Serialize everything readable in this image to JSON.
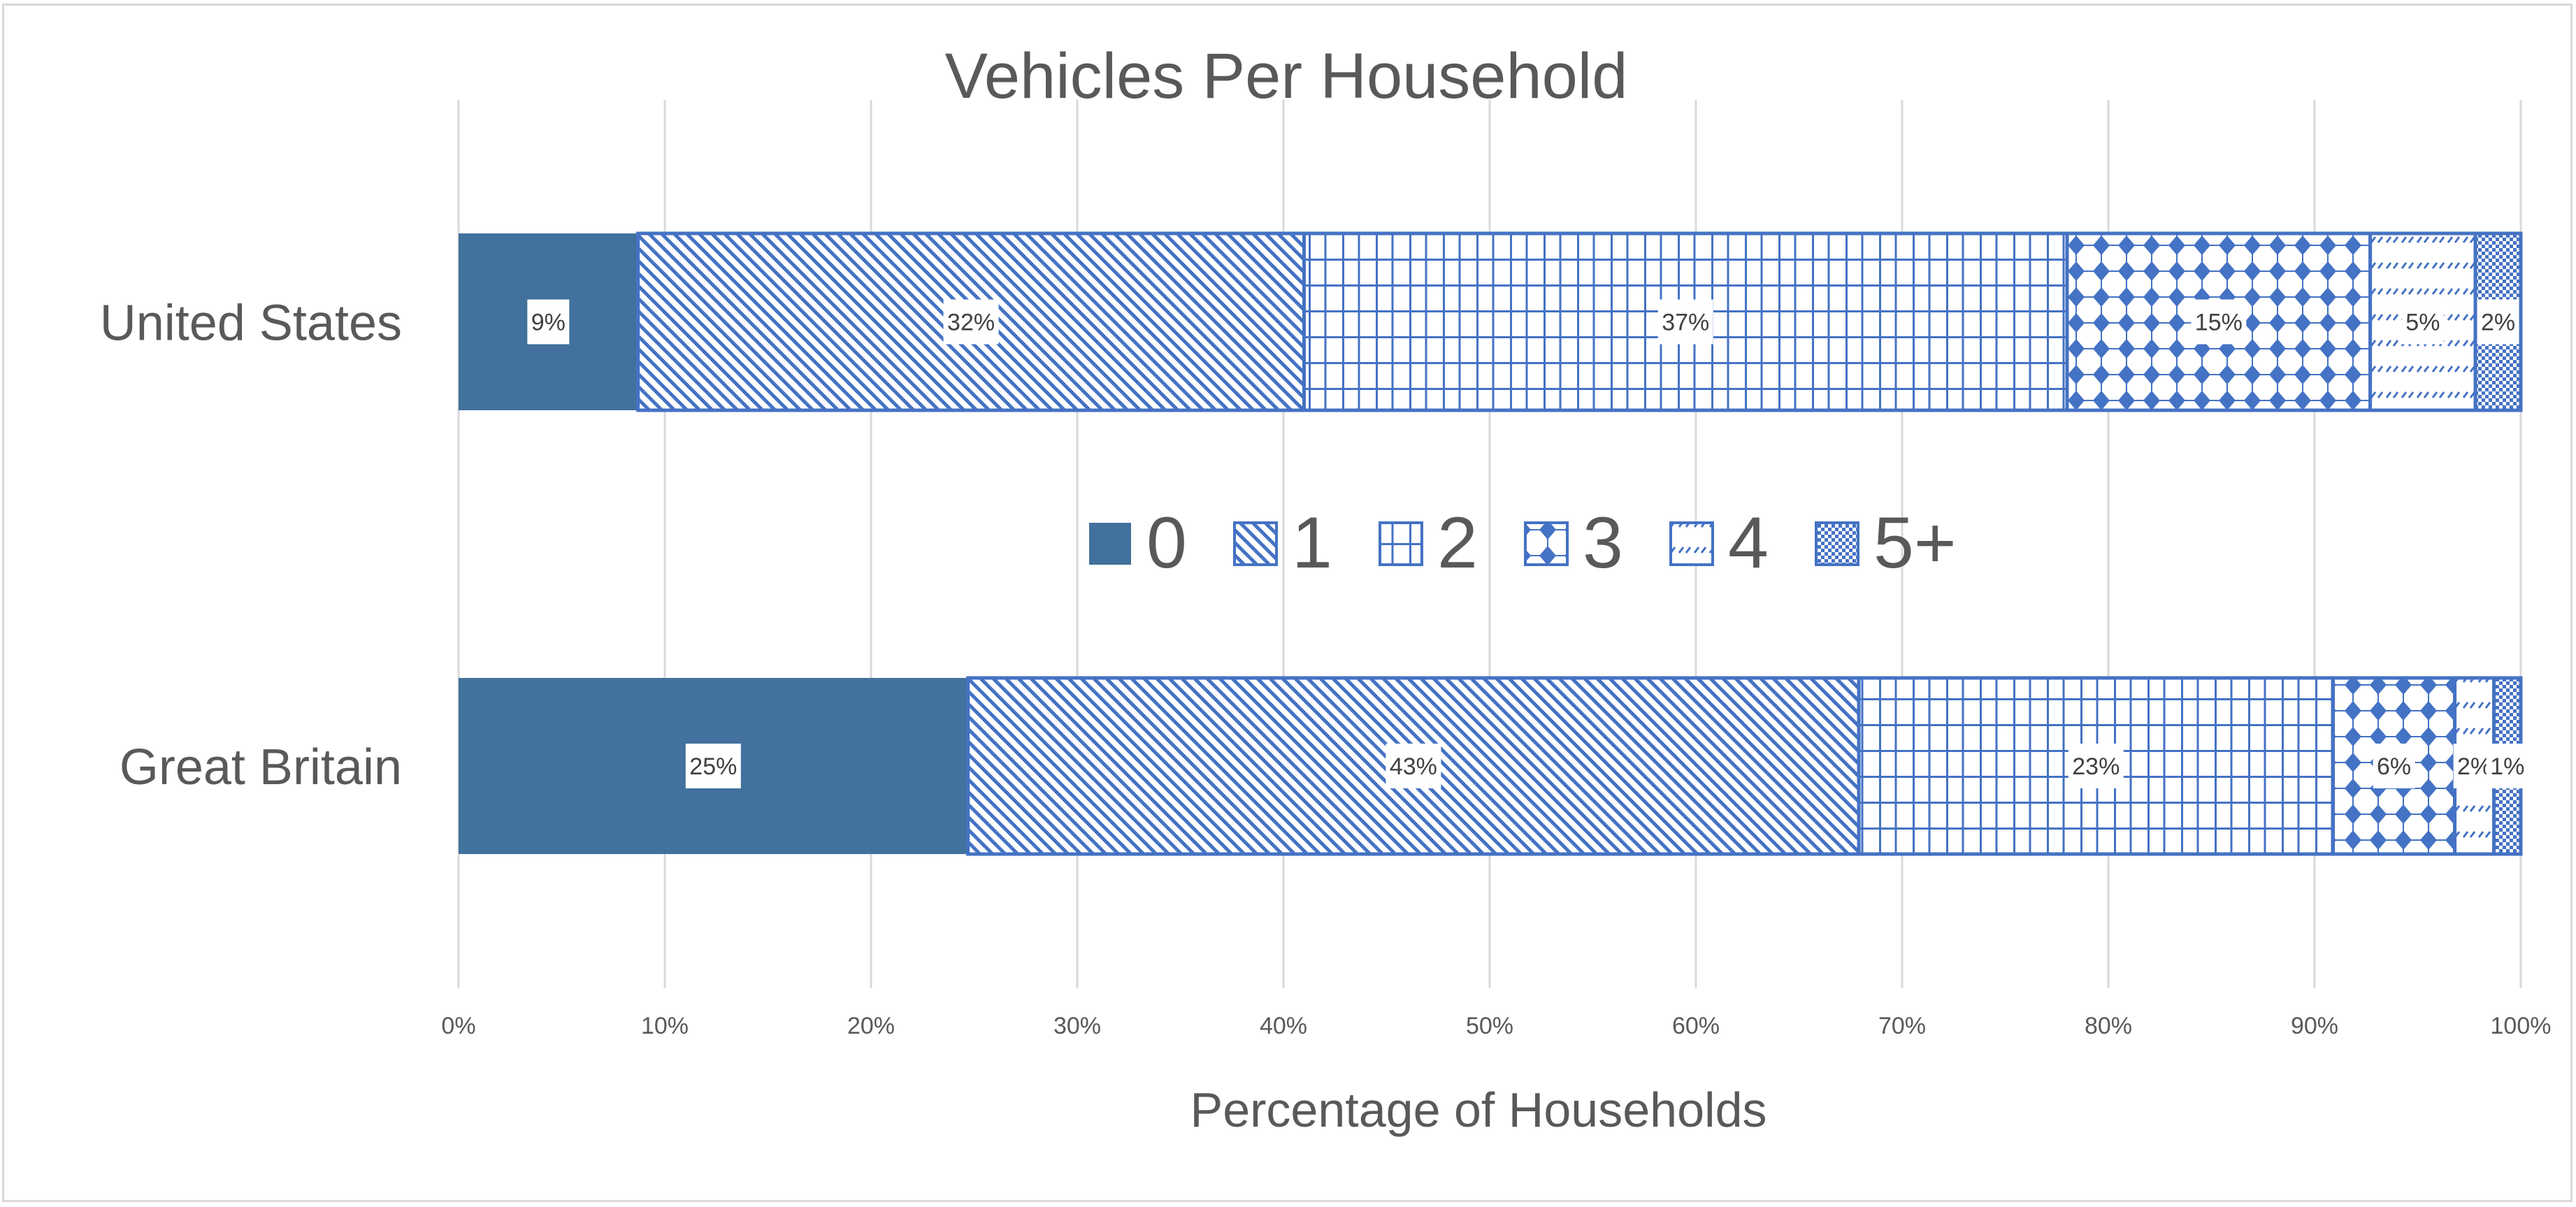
{
  "chart_data": {
    "type": "bar",
    "orientation": "horizontal",
    "stacking": "percent",
    "title": "Vehicles Per Household",
    "xlabel": "Percentage of Households",
    "ylabel": "",
    "xlim": [
      0,
      100
    ],
    "x_ticks": [
      "0%",
      "10%",
      "20%",
      "30%",
      "40%",
      "50%",
      "60%",
      "70%",
      "80%",
      "90%",
      "100%"
    ],
    "grid": "vertical",
    "legend_position": "center",
    "categories": [
      "United States",
      "Great Britain"
    ],
    "series": [
      {
        "name": "0",
        "fill": "solid",
        "color": "#41719C",
        "values": [
          8.7,
          24.7
        ],
        "labels": [
          "9%",
          "25%"
        ]
      },
      {
        "name": "1",
        "fill": "wide-downward-diagonal",
        "color": "#4472C4",
        "values": [
          32.3,
          43.2
        ],
        "labels": [
          "32%",
          "43%"
        ]
      },
      {
        "name": "2",
        "fill": "large-grid",
        "color": "#4472C4",
        "values": [
          37.0,
          23.0
        ],
        "labels": [
          "37%",
          "23%"
        ]
      },
      {
        "name": "3",
        "fill": "solid-diamond",
        "color": "#4472C4",
        "values": [
          14.7,
          5.9
        ],
        "labels": [
          "15%",
          "6%"
        ]
      },
      {
        "name": "4",
        "fill": "dashed-upward-diagonal",
        "color": "#4472C4",
        "values": [
          5.1,
          1.9
        ],
        "labels": [
          "5%",
          "2%"
        ]
      },
      {
        "name": "5+",
        "fill": "small-checkerboard",
        "color": "#4472C4",
        "values": [
          2.2,
          1.3
        ],
        "labels": [
          "2%",
          "1%"
        ]
      }
    ]
  },
  "colors": {
    "text": "#595959",
    "label_text": "#404040",
    "grid": "#d9d9d9",
    "border": "#d9d9d9",
    "solid_series": "#41719C",
    "pattern_series": "#4472C4"
  }
}
